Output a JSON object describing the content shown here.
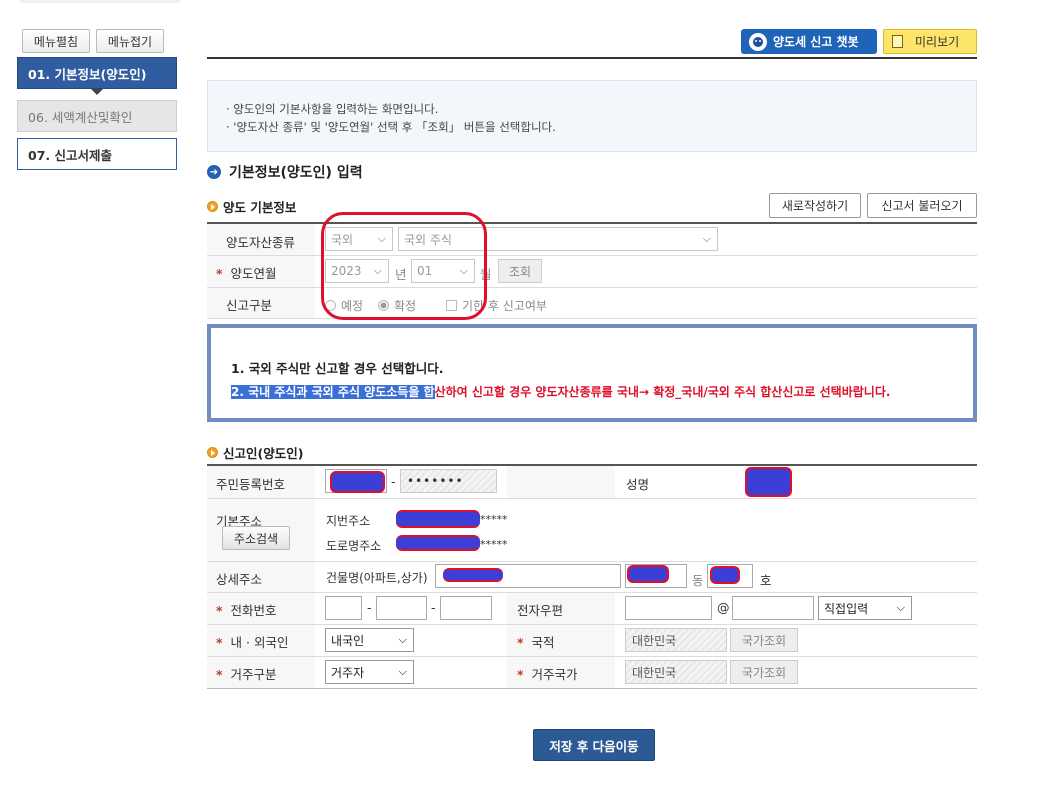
{
  "sidebar": {
    "expand_label": "메뉴펼침",
    "collapse_label": "메뉴접기",
    "items": [
      {
        "label": "01. 기본정보(양도인)"
      },
      {
        "label": "06. 세액계산및확인"
      },
      {
        "label": "07. 신고서제출"
      }
    ]
  },
  "toolbar": {
    "chatbot_label": "양도세 신고 챗봇",
    "preview_label": "미리보기"
  },
  "info": {
    "line1": "· 양도인의 기본사항을 입력하는 화면입니다.",
    "line2": "· '양도자산 종류' 및 '양도연월' 선택 후 「조회」 버튼을 선택합니다."
  },
  "page_title": "기본정보(양도인) 입력",
  "basic": {
    "section_title": "양도 기본정보",
    "new_button": "새로작성하기",
    "load_button": "신고서 불러오기",
    "asset_type_label": "양도자산종류",
    "asset_type_value": "국외",
    "asset_detail_value": "국외 주식",
    "yearmonth_label": "양도연월",
    "year_value": "2023",
    "year_unit": "년",
    "month_value": "01",
    "month_unit": "월",
    "query_button": "조회",
    "report_type_label": "신고구분",
    "radio_scheduled": "예정",
    "radio_final": "확정",
    "late_check_label": "기한 후 신고여부"
  },
  "notice": {
    "line1": "1. 국외 주식만 신고할 경우 선택합니다.",
    "line2_highlight": "2. 국내 주식과 국외 주식 양도소득을 합",
    "line2_rest": "산하여 신고할 경우 양도자산종류를 국내→ 확정_국내/국외 주식 합산신고로 선택바랍니다."
  },
  "reporter": {
    "section_title": "신고인(양도인)",
    "rrn_label": "주민등록번호",
    "rrn_dash": "-",
    "rrn_masked": "•••••••",
    "name_label": "성명",
    "address_label": "기본주소",
    "address_search_button": "주소검색",
    "jibun_label": "지번주소",
    "jibun_suffix": "*****",
    "road_label": "도로명주소",
    "road_suffix": "*****",
    "detail_label": "상세주소",
    "building_label": "건물명(아파트,상가)",
    "dong_unit": "동",
    "ho_unit": "호",
    "phone_label": "전화번호",
    "dash": "-",
    "email_label": "전자우편",
    "at_sign": "@",
    "email_domain_select": "직접입력",
    "nationality_type_label": "내 · 외국인",
    "nationality_type_value": "내국인",
    "nation_label": "국적",
    "nation_value": "대한민국",
    "nation_query_button": "국가조회",
    "residence_label": "거주구분",
    "residence_value": "거주자",
    "residence_country_label": "거주국가",
    "residence_country_value": "대한민국",
    "residence_query_button": "국가조회"
  },
  "footer": {
    "save_next_button": "저장 후 다음이동"
  },
  "colors": {
    "sidebar_active": "#2f5d9f",
    "primary_button": "#2c5a94",
    "annotation_red": "#e0102a",
    "notice_border": "#6f8ebf"
  }
}
